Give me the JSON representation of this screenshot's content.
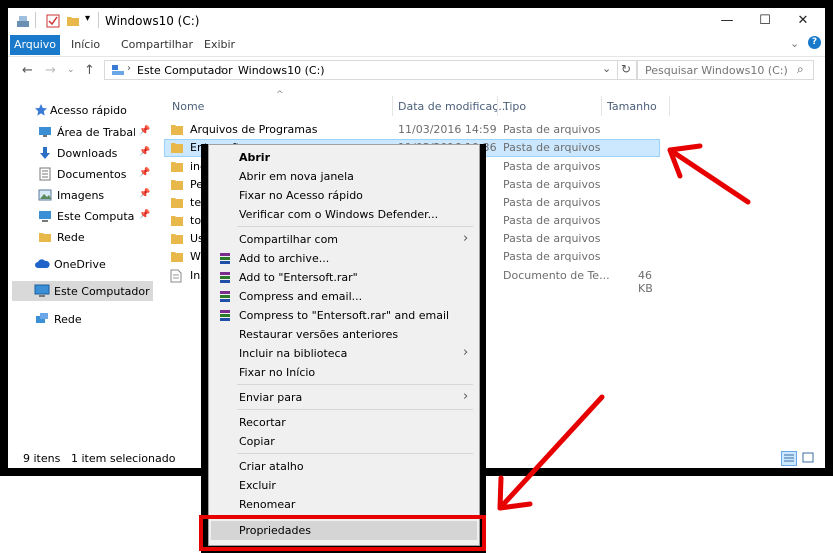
{
  "window": {
    "title": "Windows10 (C:)",
    "minimize": "—",
    "maximize": "☐",
    "close": "✕"
  },
  "ribbon": {
    "tabs": [
      "Arquivo",
      "Início",
      "Compartilhar",
      "Exibir"
    ]
  },
  "nav": {
    "path": [
      "Este Computador",
      "Windows10 (C:)"
    ],
    "search_placeholder": "Pesquisar Windows10 (C:)"
  },
  "sidebar": {
    "items": [
      {
        "label": "Acesso rápido",
        "icon": "star-icon"
      },
      {
        "label": "Área de Trabalho",
        "icon": "desktop-icon",
        "pinned": true
      },
      {
        "label": "Downloads",
        "icon": "download-icon",
        "pinned": true
      },
      {
        "label": "Documentos",
        "icon": "documents-icon",
        "pinned": true
      },
      {
        "label": "Imagens",
        "icon": "images-icon",
        "pinned": true
      },
      {
        "label": "Este Computador",
        "icon": "computer-icon",
        "pinned": true
      },
      {
        "label": "Rede",
        "icon": "folder-icon"
      },
      {
        "label": "OneDrive",
        "icon": "cloud-icon"
      },
      {
        "label": "Este Computador",
        "icon": "computer-icon",
        "selected": true
      },
      {
        "label": "Rede",
        "icon": "network-icon"
      }
    ]
  },
  "columns": {
    "name": "Nome",
    "date": "Data de modificaç...",
    "type": "Tipo",
    "size": "Tamanho"
  },
  "files": [
    {
      "name": "Arquivos de Programas",
      "date": "11/03/2016 14:59",
      "type": "Pasta de arquivos",
      "size": ""
    },
    {
      "name": "Entersoft",
      "date": "11/03/2016 10:36",
      "type": "Pasta de arquivos",
      "size": "",
      "selected": true
    },
    {
      "name": "inetpub",
      "date": "",
      "type": "Pasta de arquivos",
      "size": ""
    },
    {
      "name": "PerfLogs",
      "date": "",
      "type": "Pasta de arquivos",
      "size": ""
    },
    {
      "name": "temp",
      "date": "",
      "type": "Pasta de arquivos",
      "size": ""
    },
    {
      "name": "totalcmd",
      "date": "",
      "type": "Pasta de arquivos",
      "size": ""
    },
    {
      "name": "Usuários",
      "date": "",
      "type": "Pasta de arquivos",
      "size": ""
    },
    {
      "name": "Windows",
      "date": "",
      "type": "Pasta de arquivos",
      "size": ""
    },
    {
      "name": "Install",
      "date": "",
      "type": "Documento de Te...",
      "size": "46 KB"
    }
  ],
  "status": {
    "count": "9 itens",
    "selection": "1 item selecionado"
  },
  "context_menu": {
    "items": [
      {
        "label": "Abrir",
        "bold": true
      },
      {
        "label": "Abrir em nova janela"
      },
      {
        "label": "Fixar no Acesso rápido"
      },
      {
        "label": "Verificar com o Windows Defender..."
      },
      {
        "label": "Compartilhar com",
        "submenu": true
      },
      {
        "label": "Add to archive...",
        "icon": "winrar-icon"
      },
      {
        "label": "Add to \"Entersoft.rar\"",
        "icon": "winrar-icon"
      },
      {
        "label": "Compress and email...",
        "icon": "winrar-icon"
      },
      {
        "label": "Compress to \"Entersoft.rar\" and email",
        "icon": "winrar-icon"
      },
      {
        "label": "Restaurar versões anteriores"
      },
      {
        "label": "Incluir na biblioteca",
        "submenu": true
      },
      {
        "label": "Fixar no Início"
      },
      {
        "label": "Enviar para",
        "submenu": true
      },
      {
        "label": "Recortar"
      },
      {
        "label": "Copiar"
      },
      {
        "label": "Criar atalho"
      },
      {
        "label": "Excluir"
      },
      {
        "label": "Renomear"
      },
      {
        "label": "Propriedades",
        "highlighted": true
      }
    ]
  },
  "colors": {
    "accent": "#1979ca",
    "selection": "#cce8ff",
    "annotation": "#e60000",
    "folder": "#e8b84a"
  }
}
